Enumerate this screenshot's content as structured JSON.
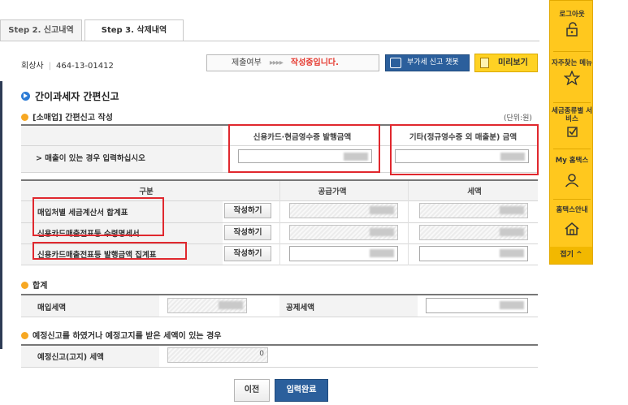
{
  "tabs": [
    {
      "label": "Step 2. 신고내역"
    },
    {
      "label": "Step 3. 삭제내역"
    }
  ],
  "business": {
    "name": "회상사",
    "number": "464-13-01412"
  },
  "status": {
    "label": "제출여부",
    "arrows": "▸▸▸▸",
    "state": "작성중입니다."
  },
  "header_buttons": {
    "vat_help": "부가세 신고 챗봇",
    "preview": "미리보기"
  },
  "page_title": "간이과세자 간편신고",
  "section_retail": {
    "title": "[소매업] 간편신고 작성",
    "unit": "(단위:원)",
    "col_card": "신용카드·현금영수증 발행금액",
    "col_other": "기타(정규영수증 외 매출분) 금액",
    "row_label": "> 매출이 있는 경우 입력하십시오"
  },
  "purchase_table": {
    "headers": [
      "구분",
      "공급가액",
      "세액"
    ],
    "write_label": "작성하기",
    "rows": [
      {
        "label": "매입처별 세금계산서 합계표"
      },
      {
        "label": "신용카드매출전표등 수령명세서"
      },
      {
        "label": "신용카드매출전표등 발행금액 집계표"
      }
    ]
  },
  "total": {
    "title": "합계",
    "purchase_tax_label": "매입세액",
    "deduction_tax_label": "공제세액"
  },
  "prelim": {
    "title": "예정신고를 하였거나 예정고지를 받은 세액이 있는 경우",
    "label": "예정신고(고지) 세액",
    "value": "0"
  },
  "bottom_buttons": {
    "prev": "이전",
    "done": "입력완료"
  },
  "quick_menu": {
    "items": [
      {
        "label": "로그아웃",
        "icon": "lock-icon"
      },
      {
        "label": "자주찾는 메뉴",
        "icon": "star-icon"
      },
      {
        "label": "세금종류별 서비스",
        "icon": "checkbox-icon"
      },
      {
        "label": "My 홈택스",
        "icon": "person-icon"
      },
      {
        "label": "홈택스안내",
        "icon": "home-info-icon"
      }
    ],
    "collapse": "접기 ^"
  },
  "colors": {
    "accent_blue": "#2b5f9c",
    "highlight_red": "#e0282e",
    "quick_menu_yellow": "#ffc81e",
    "progress_red": "#e5372d"
  }
}
